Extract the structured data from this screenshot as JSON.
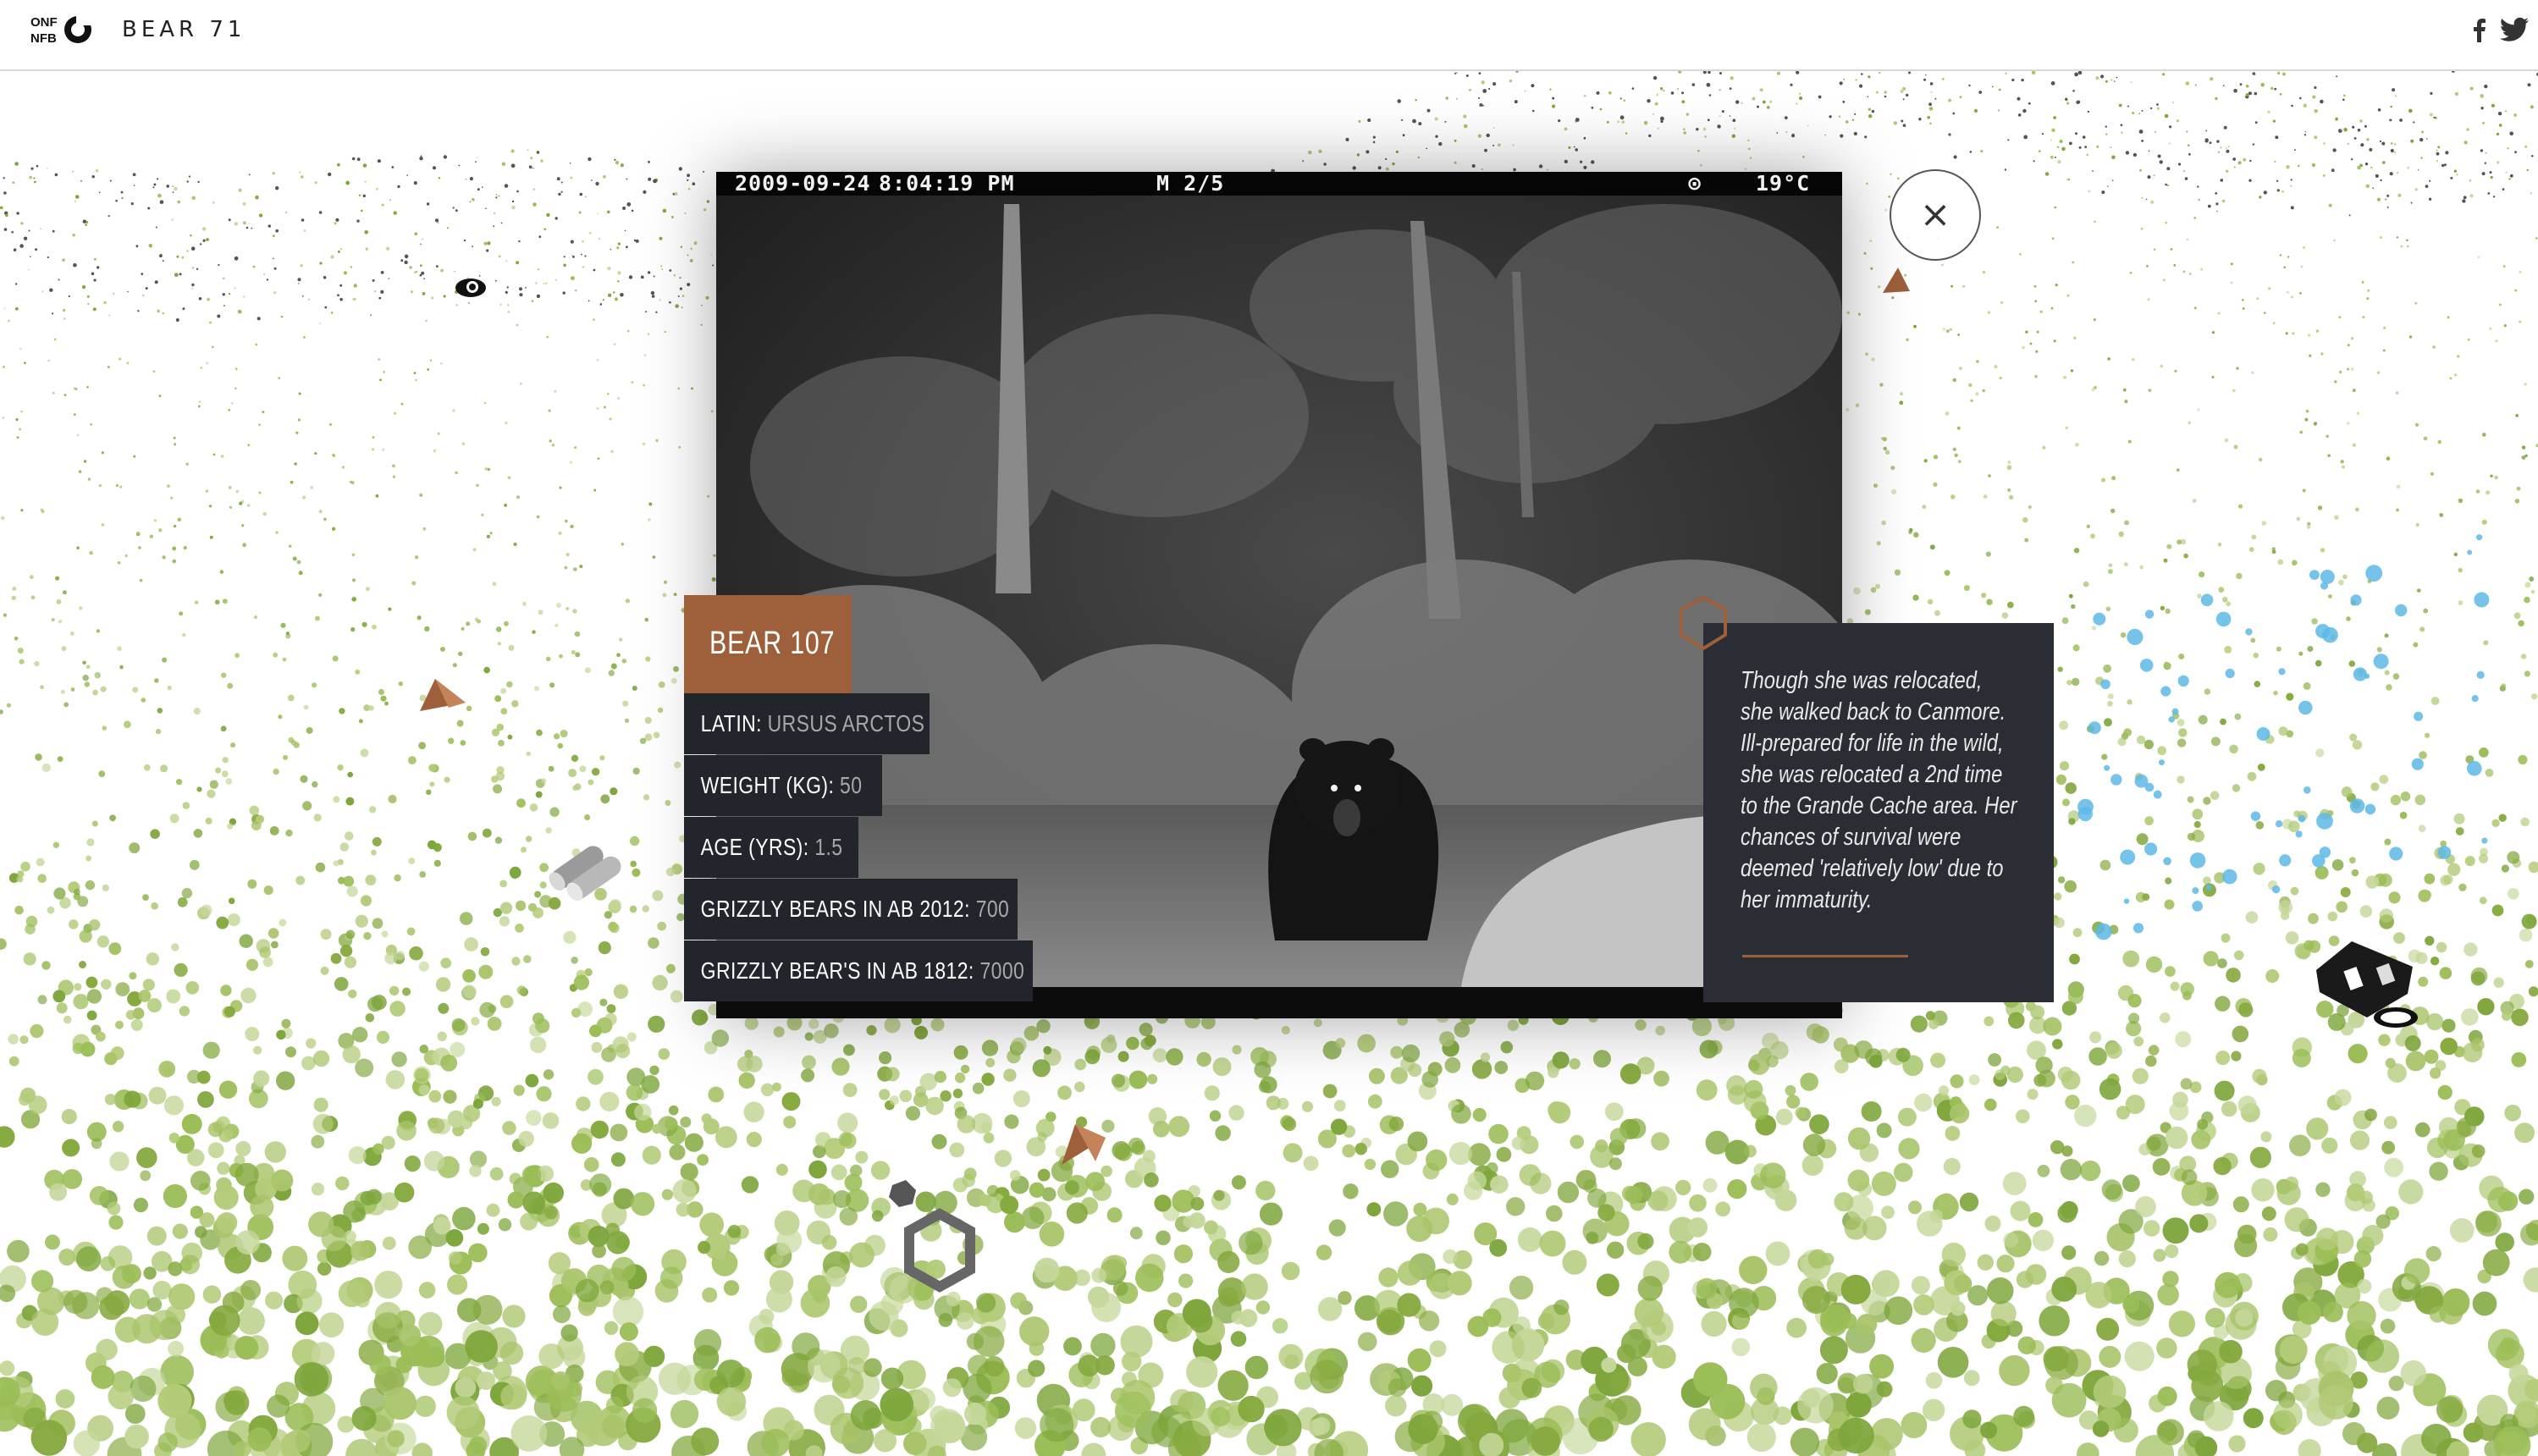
{
  "header": {
    "title": "BEAR 71",
    "logo_lines": [
      "ONF",
      "NFB"
    ]
  },
  "share": {
    "facebook_icon": "facebook-icon",
    "twitter_icon": "twitter-icon"
  },
  "camera": {
    "date": "2009-09-24",
    "time": "8:04:19 PM",
    "mode": "M 2/5",
    "moon": "⊙",
    "temperature": "19°C"
  },
  "close": {
    "icon": "close-icon",
    "label": "×"
  },
  "bear": {
    "name": "BEAR 107",
    "stats": [
      {
        "label": "LATIN",
        "value": "URSUS ARCTOS"
      },
      {
        "label": "WEIGHT (KG)",
        "value": "50"
      },
      {
        "label": "AGE (YRS)",
        "value": "1.5"
      },
      {
        "label": "GRIZZLY BEARS IN AB 2012",
        "value": "700"
      },
      {
        "label": "GRIZZLY BEAR'S IN AB 1812",
        "value": "7000"
      }
    ]
  },
  "story": {
    "text": "Though she was relocated, she walked back to Canmore. Ill-prepared for life in the wild, she was relocated a 2nd time to the Grande Cache area. Her chances of survival were deemed 'relatively low' due to her immaturity."
  },
  "colors": {
    "accent_rust": "#9e5f3b",
    "panel_dark": "#22252b",
    "dot_green": "#8db04a",
    "dot_blue": "#5eb8e6"
  }
}
